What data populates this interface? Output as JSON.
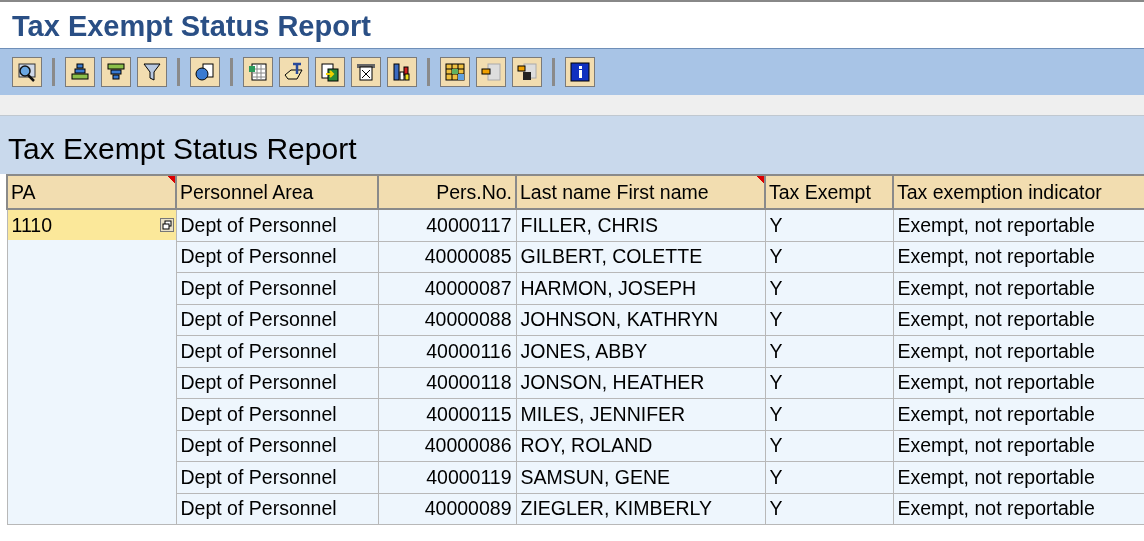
{
  "page_title": "Tax Exempt Status Report",
  "report": {
    "title": "Tax Exempt Status Report",
    "columns": [
      {
        "label": "PA",
        "sorted": true
      },
      {
        "label": "Personnel Area",
        "sorted": false
      },
      {
        "label": "Pers.No.",
        "sorted": false
      },
      {
        "label": "Last name First name",
        "sorted": true
      },
      {
        "label": "Tax Exempt",
        "sorted": false
      },
      {
        "label": "Tax exemption indicator",
        "sorted": false
      }
    ],
    "group": {
      "pa": "1110",
      "selected": true
    },
    "rows": [
      {
        "area": "Dept of Personnel",
        "pers_no": "40000117",
        "name": "FILLER, CHRIS",
        "exempt": "Y",
        "indicator": "Exempt, not reportable"
      },
      {
        "area": "Dept of Personnel",
        "pers_no": "40000085",
        "name": "GILBERT, COLETTE",
        "exempt": "Y",
        "indicator": "Exempt, not reportable"
      },
      {
        "area": "Dept of Personnel",
        "pers_no": "40000087",
        "name": "HARMON, JOSEPH",
        "exempt": "Y",
        "indicator": "Exempt, not reportable"
      },
      {
        "area": "Dept of Personnel",
        "pers_no": "40000088",
        "name": "JOHNSON, KATHRYN",
        "exempt": "Y",
        "indicator": "Exempt, not reportable"
      },
      {
        "area": "Dept of Personnel",
        "pers_no": "40000116",
        "name": "JONES, ABBY",
        "exempt": "Y",
        "indicator": "Exempt, not reportable"
      },
      {
        "area": "Dept of Personnel",
        "pers_no": "40000118",
        "name": "JONSON, HEATHER",
        "exempt": "Y",
        "indicator": "Exempt, not reportable"
      },
      {
        "area": "Dept of Personnel",
        "pers_no": "40000115",
        "name": "MILES, JENNIFER",
        "exempt": "Y",
        "indicator": "Exempt, not reportable"
      },
      {
        "area": "Dept of Personnel",
        "pers_no": "40000086",
        "name": "ROY, ROLAND",
        "exempt": "Y",
        "indicator": "Exempt, not reportable"
      },
      {
        "area": "Dept of Personnel",
        "pers_no": "40000119",
        "name": "SAMSUN, GENE",
        "exempt": "Y",
        "indicator": "Exempt, not reportable"
      },
      {
        "area": "Dept of Personnel",
        "pers_no": "40000089",
        "name": "ZIEGLER, KIMBERLY",
        "exempt": "Y",
        "indicator": "Exempt, not reportable"
      }
    ]
  }
}
